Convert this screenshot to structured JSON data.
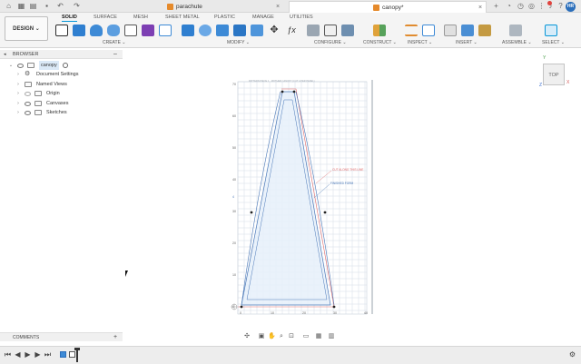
{
  "tabs": {
    "doc1": "parachute",
    "doc2": "canopy*"
  },
  "ribbon": {
    "design": "DESIGN ⌄",
    "tabs": [
      "SOLID",
      "SURFACE",
      "MESH",
      "SHEET METAL",
      "PLASTIC",
      "MANAGE",
      "UTILITIES"
    ],
    "groups": [
      "CREATE ⌄",
      "MODIFY ⌄",
      "CONFIGURE ⌄",
      "CONSTRUCT ⌄",
      "INSPECT ⌄",
      "INSERT ⌄",
      "ASSEMBLE ⌄",
      "SELECT ⌄"
    ]
  },
  "browser": {
    "title": "BROWSER",
    "items": [
      "canopy",
      "Document Settings",
      "Named Views",
      "Origin",
      "Canvases",
      "Sketches"
    ]
  },
  "comments": {
    "title": "COMMENTS"
  },
  "viewcube": {
    "face": "TOP",
    "axis_y": "Y",
    "axis_x": "X",
    "axis_z": "Z"
  },
  "user": {
    "initials": "HR"
  },
  "sketch": {
    "y_ticks": [
      "70",
      "60",
      "50",
      "40",
      "30",
      "20",
      "10",
      "0"
    ],
    "x_ticks": [
      "0",
      "10",
      "20",
      "30",
      "40"
    ],
    "tick_extra": "4",
    "annotations": [
      "CUT ALONG THIS LINE",
      "FINISHED FORM"
    ],
    "header_note": "PATTERN PIECE 1 · MOTHER CANOPY (CUT 4 PER PANEL)"
  },
  "colors": {
    "accent": "#0696d7",
    "sketch_fill": "#e6f0fa",
    "grid": "#cfd8e3",
    "red_line": "#e06a6a",
    "blue_line": "#4a78b8"
  }
}
